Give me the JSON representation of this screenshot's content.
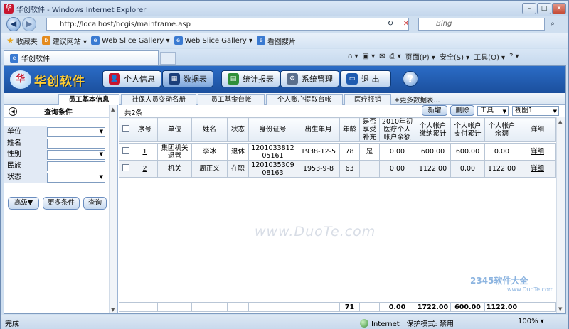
{
  "window": {
    "title": "华创软件 - Windows Internet Explorer",
    "app_icon_glyph": "华",
    "minimize": "–",
    "maximize": "□",
    "close": "✕"
  },
  "address_bar": {
    "back": "◀",
    "forward": "▶",
    "url": "http://localhost/hcgis/mainframe.asp",
    "refresh": "↻",
    "stop": "✕",
    "search_placeholder": "Bing",
    "search_icon": "⌕"
  },
  "favorites": {
    "label": "收藏夹",
    "items": [
      "建议网站 ▾",
      "Web Slice Gallery ▾",
      "Web Slice Gallery ▾",
      "看图搜片"
    ]
  },
  "ie_tab": {
    "label": "华创软件"
  },
  "command_bar": {
    "items": [
      "⌂ ▾",
      "▣ ▾",
      "✉",
      "⎙ ▾",
      "页面(P) ▾",
      "安全(S) ▾",
      "工具(O) ▾",
      "? ▾"
    ]
  },
  "app_header": {
    "logo_glyph": "华",
    "logo_text": "华创软件",
    "buttons": [
      "个人信息",
      "数据表",
      "统计报表",
      "系统管理",
      "退  出"
    ],
    "button_icons": [
      "👤",
      "▦",
      "▤",
      "⚙",
      "▭"
    ],
    "help_label": "?"
  },
  "sub_tabs": {
    "items": [
      "员工基本信息",
      "社保人员变动名册",
      "员工基金台帐",
      "个人账户提取台帐",
      "医疗报销"
    ],
    "more": "+更多数据表..."
  },
  "query_panel": {
    "toggle_icon": "◀",
    "title": "查询条件",
    "fields": [
      {
        "label": "单位",
        "type": "select"
      },
      {
        "label": "姓名",
        "type": "text"
      },
      {
        "label": "性别",
        "type": "select"
      },
      {
        "label": "民族",
        "type": "text"
      },
      {
        "label": "状态",
        "type": "select"
      }
    ],
    "buttons": [
      "高级▼",
      "更多条件",
      "查询"
    ],
    "scroll_up": "▲",
    "scroll_down": "▼"
  },
  "grid_toolbar": {
    "count": "共2条",
    "new_button": "新增",
    "delete_button": "删除",
    "tools_select": "工具",
    "view_select": "视图1"
  },
  "grid": {
    "columns": [
      "",
      "序号",
      "单位",
      "姓名",
      "状态",
      "身份证号",
      "出生年月",
      "年龄",
      "是否享受补充",
      "2010年初医疗个人帐户余额",
      "个人帐户缴纳累计",
      "个人帐户支付累计",
      "个人帐户余额",
      "详细"
    ],
    "rows": [
      {
        "seq": "1",
        "unit": "集团机关退管",
        "name": "李冰",
        "status": "退休",
        "id": "120103381205161",
        "birth": "1938-12-5",
        "age": "78",
        "supp": "是",
        "bal2010": "0.00",
        "paid": "600.00",
        "spent": "600.00",
        "balance": "0.00",
        "detail": "详细"
      },
      {
        "seq": "2",
        "unit": "机关",
        "name": "周正义",
        "status": "在职",
        "id": "120103530908163",
        "birth": "1953-9-8",
        "age": "63",
        "supp": "",
        "bal2010": "0.00",
        "paid": "1122.00",
        "spent": "0.00",
        "balance": "1122.00",
        "detail": "详细"
      }
    ],
    "totals": {
      "age": "71",
      "bal2010": "0.00",
      "paid": "1722.00",
      "spent": "600.00",
      "balance": "1122.00"
    }
  },
  "status_bar": {
    "left": "完成",
    "zone": "Internet | 保护模式: 禁用",
    "zoom": "100% ▾"
  },
  "watermark": {
    "brand": "2345软件大全",
    "url": "www.DuoTe.com",
    "center": "www.DuoTe.com"
  }
}
